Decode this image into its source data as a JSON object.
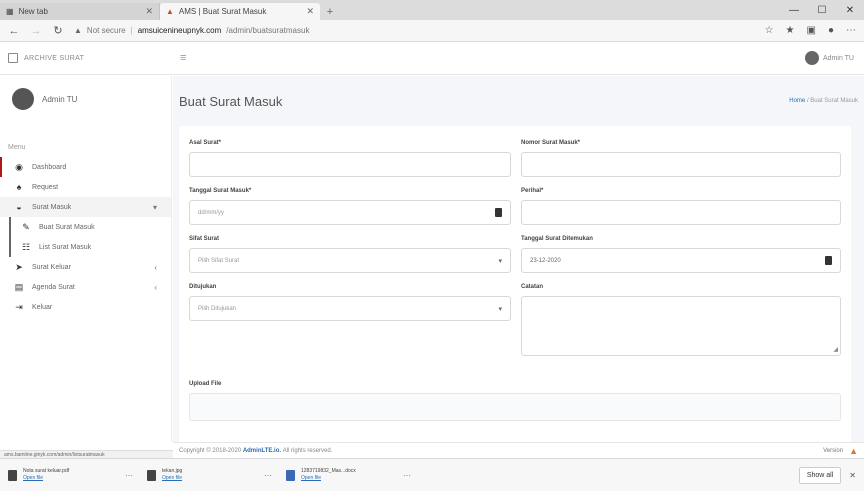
{
  "browser": {
    "tabs": [
      {
        "title": "New tab"
      },
      {
        "title": "AMS | Buat Surat Masuk"
      }
    ],
    "url": {
      "security": "Not secure",
      "host": "amsuicenineupnyk.com",
      "path": "/admin/buatsuratmasuk"
    }
  },
  "app": {
    "brand": "ARCHIVE SURAT",
    "user_name_top": "Admin TU",
    "user_name": "Admin TU"
  },
  "sidebar": {
    "menu_header": "Menu",
    "items": [
      {
        "label": "Dashboard",
        "icon": "dashboard-icon"
      },
      {
        "label": "Request",
        "icon": "bell-icon"
      },
      {
        "label": "Surat Masuk",
        "icon": "inbox-icon"
      },
      {
        "label": "Surat Keluar",
        "icon": "send-icon"
      },
      {
        "label": "Agenda Surat",
        "icon": "book-icon"
      },
      {
        "label": "Keluar",
        "icon": "sign-out-icon"
      }
    ],
    "submenu": [
      {
        "label": "Buat Surat Masuk",
        "icon": "pencil-icon"
      },
      {
        "label": "List Surat Masuk",
        "icon": "list-icon"
      }
    ]
  },
  "page": {
    "title": "Buat Surat Masuk",
    "breadcrumb_home": "Home",
    "breadcrumb_sep": "/",
    "breadcrumb_current": "Buat Surat Masuk"
  },
  "form": {
    "asal_surat": {
      "label": "Asal Surat*",
      "value": ""
    },
    "nomor_surat": {
      "label": "Nomor Surat Masuk*",
      "value": ""
    },
    "tanggal_masuk": {
      "label": "Tanggal Surat Masuk*",
      "placeholder": "dd/mm/yy"
    },
    "perihal": {
      "label": "Perihal*",
      "value": ""
    },
    "sifat_surat": {
      "label": "Sifat Surat",
      "selected": "Pilih Sifat Surat"
    },
    "tanggal_ditemukan": {
      "label": "Tanggal Surat Ditemukan",
      "value": "23-12-2020"
    },
    "ditujukan": {
      "label": "Ditujukan",
      "selected": "Pilih Ditujukan"
    },
    "catatan": {
      "label": "Catatan",
      "value": ""
    },
    "upload": {
      "label": "Upload File"
    }
  },
  "footer": {
    "prefix": "Copyright © 2018-2020",
    "link": "AdminLTE.io.",
    "suffix": "All rights reserved.",
    "version": "Version"
  },
  "status_url": "ams.bamiine.ginyk.com/admin/listsuratmasuk",
  "downloads": [
    {
      "name": "Nota surat keluar.pdf",
      "action": "Open file"
    },
    {
      "name": "tekan.jpg",
      "action": "Open file"
    },
    {
      "name": "1283719832_Mas...docx",
      "action": "Open file"
    }
  ],
  "show_all": "Show all",
  "colors": {
    "accent": "#2a6cb5",
    "active_marker": "#b01818",
    "content_bg": "#f4f6f9"
  }
}
